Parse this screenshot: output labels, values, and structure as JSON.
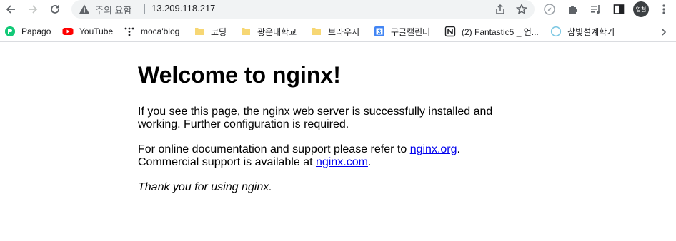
{
  "toolbar": {
    "back_icon": "arrow-left-icon",
    "forward_icon": "arrow-right-icon",
    "reload_icon": "reload-icon",
    "security_label": "주의 요함",
    "url": "13.209.118.217",
    "avatar_text": "영철"
  },
  "bookmarks": [
    {
      "label": "Papago",
      "icon": "papago-icon"
    },
    {
      "label": "YouTube",
      "icon": "youtube-icon"
    },
    {
      "label": "moca'blog",
      "icon": "moca-icon"
    },
    {
      "label": "코딩",
      "icon": "folder-icon"
    },
    {
      "label": "광운대학교",
      "icon": "folder-icon"
    },
    {
      "label": "브라우저",
      "icon": "folder-icon"
    },
    {
      "label": "구글캘린더",
      "icon": "calendar-icon"
    },
    {
      "label": "(2) Fantastic5 _ 언...",
      "icon": "notion-icon"
    },
    {
      "label": "참빛설계학기",
      "icon": "circle-icon"
    }
  ],
  "page": {
    "heading": "Welcome to nginx!",
    "para1": "If you see this page, the nginx web server is successfully installed and working. Further configuration is required.",
    "para2_prefix": "For online documentation and support please refer to ",
    "link1": "nginx.org",
    "para2_mid": ".",
    "para2_line2": "Commercial support is available at ",
    "link2": "nginx.com",
    "para2_end": ".",
    "thanks": "Thank you for using nginx."
  },
  "colors": {
    "link": "#0000ee",
    "omnibox_bg": "#f1f3f4",
    "youtube_red": "#ff0000",
    "folder_yellow": "#f7d774"
  }
}
